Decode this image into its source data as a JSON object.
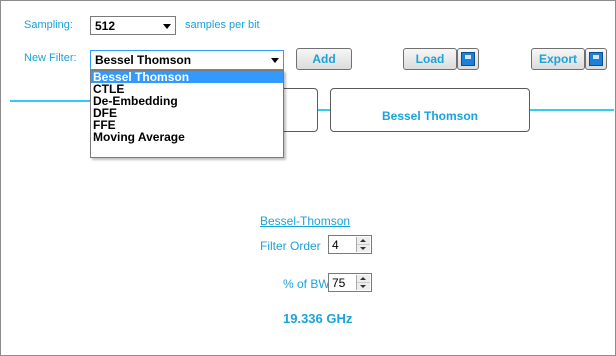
{
  "sampling": {
    "label": "Sampling:",
    "value": "512",
    "suffix": "samples per bit"
  },
  "new_filter": {
    "label": "New Filter:",
    "value": "Bessel Thomson",
    "options": [
      "Bessel Thomson",
      "CTLE",
      "De-Embedding",
      "DFE",
      "FFE",
      "Moving Average"
    ],
    "highlighted_index": 0
  },
  "buttons": {
    "add": "Add",
    "load": "Load",
    "export": "Export"
  },
  "pipeline": {
    "node_label": "Bessel Thomson"
  },
  "panel": {
    "title": "Bessel-Thomson",
    "filter_order_label": "Filter Order",
    "filter_order_value": "4",
    "bw_label": "% of BW",
    "bw_value": "75",
    "frequency": "19.336 GHz"
  },
  "colors": {
    "accent": "#1aa3d9",
    "line": "#33ccf0",
    "selection": "#3399ff"
  },
  "icons": {
    "load": "open-folder-icon",
    "export": "save-disk-icon"
  }
}
